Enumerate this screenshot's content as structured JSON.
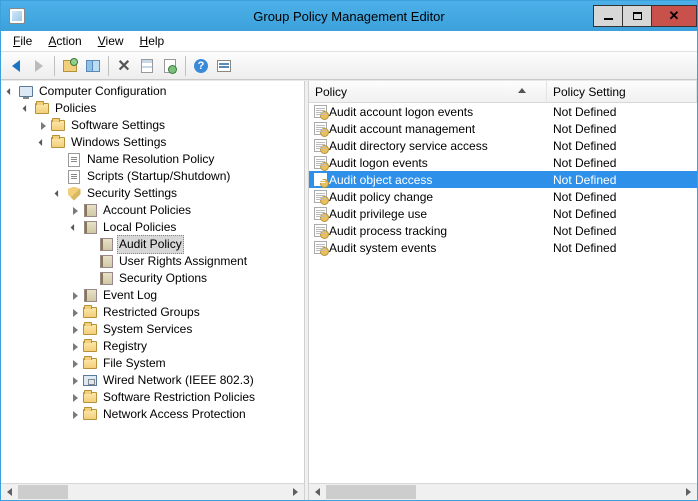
{
  "window": {
    "title": "Group Policy Management Editor"
  },
  "menus": {
    "file": "File",
    "action": "Action",
    "view": "View",
    "help": "Help"
  },
  "tree": {
    "root": "Computer Configuration",
    "policies": "Policies",
    "software": "Software Settings",
    "windows": "Windows Settings",
    "nrp": "Name Resolution Policy",
    "scripts": "Scripts (Startup/Shutdown)",
    "security": "Security Settings",
    "acct": "Account Policies",
    "local": "Local Policies",
    "audit": "Audit Policy",
    "ura": "User Rights Assignment",
    "secop": "Security Options",
    "eventlog": "Event Log",
    "restricted": "Restricted Groups",
    "sysserv": "System Services",
    "registry": "Registry",
    "filesys": "File System",
    "wired": "Wired Network (IEEE 802.3) ",
    "srp": "Software Restriction Policies",
    "nap": "Network Access Protection"
  },
  "list": {
    "col_policy": "Policy",
    "col_setting": "Policy Setting",
    "rows": [
      {
        "name": "Audit account logon events",
        "setting": "Not Defined",
        "selected": false
      },
      {
        "name": "Audit account management",
        "setting": "Not Defined",
        "selected": false
      },
      {
        "name": "Audit directory service access",
        "setting": "Not Defined",
        "selected": false
      },
      {
        "name": "Audit logon events",
        "setting": "Not Defined",
        "selected": false
      },
      {
        "name": "Audit object access",
        "setting": "Not Defined",
        "selected": true
      },
      {
        "name": "Audit policy change",
        "setting": "Not Defined",
        "selected": false
      },
      {
        "name": "Audit privilege use",
        "setting": "Not Defined",
        "selected": false
      },
      {
        "name": "Audit process tracking",
        "setting": "Not Defined",
        "selected": false
      },
      {
        "name": "Audit system events",
        "setting": "Not Defined",
        "selected": false
      }
    ]
  }
}
